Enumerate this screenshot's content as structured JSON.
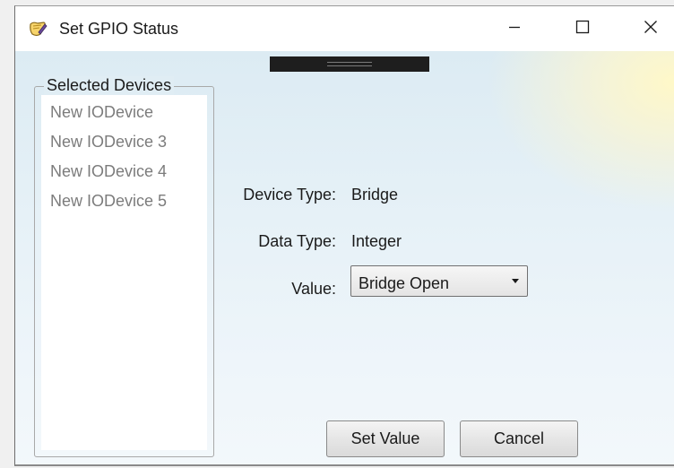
{
  "window": {
    "title": "Set GPIO Status",
    "icon": "notepad-edit-icon"
  },
  "caption_buttons": {
    "minimize": "minimize-icon",
    "maximize": "maximize-icon",
    "close": "close-icon"
  },
  "selected_devices": {
    "legend": "Selected Devices",
    "items": [
      {
        "label": "New IODevice"
      },
      {
        "label": "New IODevice 3"
      },
      {
        "label": "New IODevice 4"
      },
      {
        "label": "New IODevice 5"
      }
    ]
  },
  "details": {
    "device_type_label": "Device Type:",
    "device_type_value": "Bridge",
    "data_type_label": "Data Type:",
    "data_type_value": "Integer",
    "value_label": "Value:",
    "value_selected": "Bridge Open"
  },
  "buttons": {
    "set_value": "Set Value",
    "cancel": "Cancel"
  },
  "colors": {
    "client_background": "#e2eef5",
    "highlight_glow": "#fff6c8",
    "disabled_text": "#7c7c7c"
  }
}
